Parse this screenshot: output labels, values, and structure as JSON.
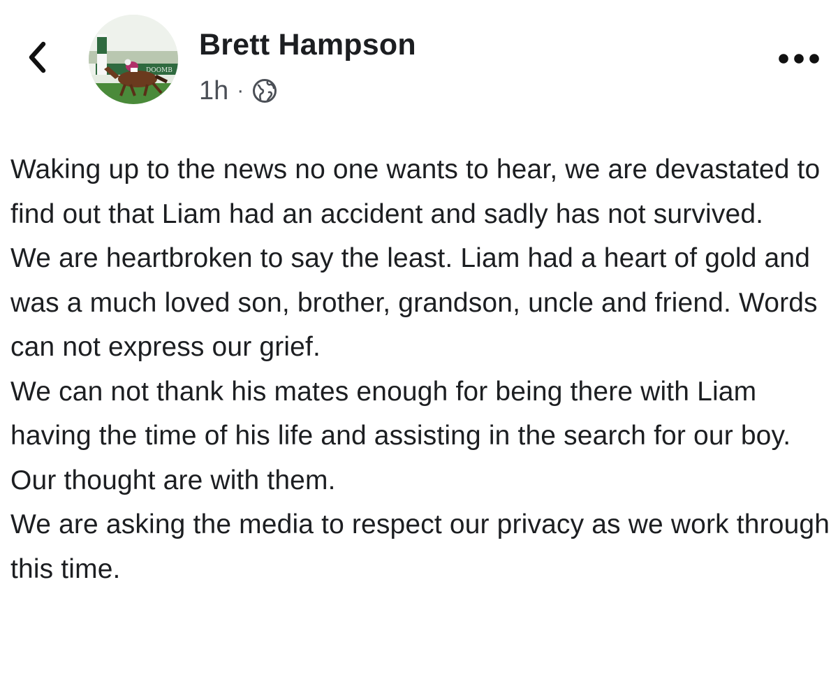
{
  "post": {
    "author": "Brett Hampson",
    "time": "1h",
    "separator": "·",
    "audience_icon": "globe-icon",
    "avatar_sign_text": "DOOMB",
    "paragraphs": [
      "Waking up to the news no one wants to hear, we are devastated to find out that Liam had an accident and sadly has not survived.",
      "We are heartbroken to say the least. Liam had a heart of gold and was a much loved son, brother, grandson, uncle and friend. Words can not express our grief.",
      "We can not thank his mates enough for being there with Liam having the time of his life and assisting in the search for our boy. Our thought are with them.",
      "We are asking the media to respect our privacy as we work through this time."
    ]
  },
  "icons": {
    "back": "chevron-left-icon",
    "more": "more-dots-icon"
  },
  "colors": {
    "text": "#1c1e21",
    "meta_text": "#4b4f56",
    "background": "#ffffff"
  }
}
